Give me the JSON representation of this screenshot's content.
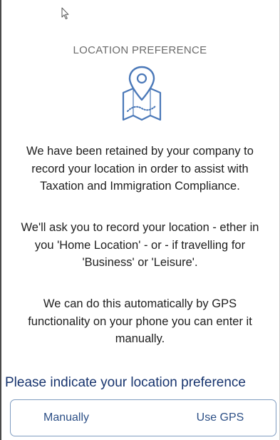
{
  "header": {
    "title": "LOCATION PREFERENCE",
    "icon": "map-location-icon"
  },
  "body": {
    "paragraph_1": "We have been retained by your company to\nrecord your location in order to assist with\nTaxation and Immigration Compliance.",
    "paragraph_2": "We'll ask you to record your location - ether in\nyou 'Home Location' - or - if travelling for\n'Business' or 'Leisure'.",
    "paragraph_3": "We can do this automatically by GPS\nfunctionality on your phone you can enter it\nmanually."
  },
  "preference": {
    "question": "Please indicate your location preference",
    "options": [
      {
        "label": "Manually"
      },
      {
        "label": "Use GPS"
      }
    ]
  },
  "colors": {
    "title": "#6b6b6b",
    "icon": "#4a78b8",
    "question": "#17346e",
    "button_text": "#2c4f86",
    "button_border": "#7f9cc0"
  }
}
